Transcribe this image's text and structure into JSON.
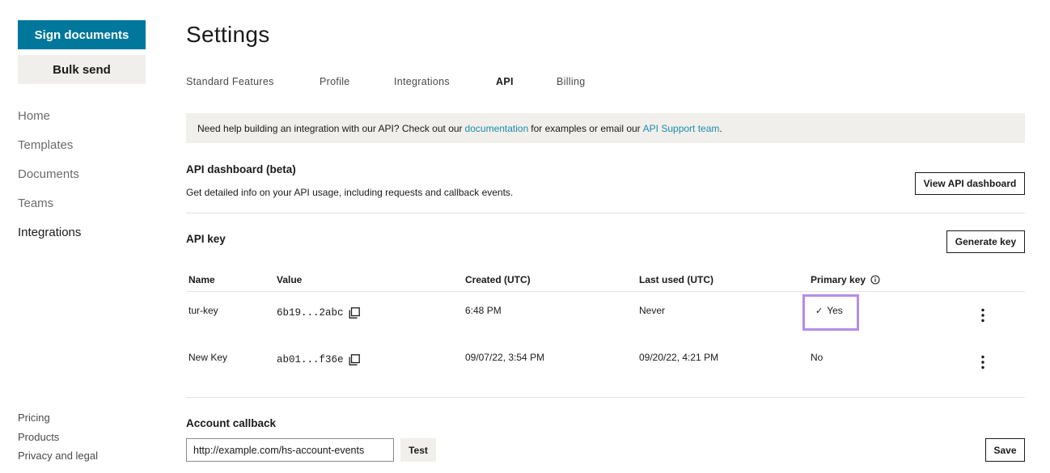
{
  "sidebar": {
    "sign_documents": "Sign documents",
    "bulk_send": "Bulk send",
    "nav": [
      "Home",
      "Templates",
      "Documents",
      "Teams",
      "Integrations"
    ],
    "footer": [
      "Pricing",
      "Products",
      "Privacy and legal"
    ]
  },
  "page": {
    "title": "Settings",
    "tabs": [
      "Standard Features",
      "Profile",
      "Integrations",
      "API",
      "Billing"
    ],
    "active_tab": "API"
  },
  "banner": {
    "text_1": "Need help building an integration with our API? Check out our",
    "link_docs": "documentation",
    "text_2": "for examples or email our",
    "link_support": "API Support team",
    "text_3": "."
  },
  "api_dashboard": {
    "title": "API dashboard (beta)",
    "description": "Get detailed info on your API usage, including requests and callback events.",
    "button": "View API dashboard"
  },
  "api_key": {
    "title": "API key",
    "generate_button": "Generate key",
    "columns": {
      "name": "Name",
      "value": "Value",
      "created": "Created (UTC)",
      "last_used": "Last used (UTC)",
      "primary": "Primary key"
    },
    "rows": [
      {
        "name": "tur-key",
        "value": "6b19...2abc",
        "created": "6:48 PM",
        "last_used": "Never",
        "primary": "Yes"
      },
      {
        "name": "New Key",
        "value": "ab01...f36e",
        "created": "09/07/22, 3:54 PM",
        "last_used": "09/20/22, 4:21 PM",
        "primary": "No"
      }
    ]
  },
  "account_callback": {
    "title": "Account callback",
    "input_value": "http://example.com/hs-account-events",
    "test_button": "Test",
    "save_button": "Save"
  },
  "colors": {
    "primary": "#00779b",
    "link": "#1a8caf",
    "banner_bg": "#f1efeb",
    "highlight": "#b68ce8"
  }
}
